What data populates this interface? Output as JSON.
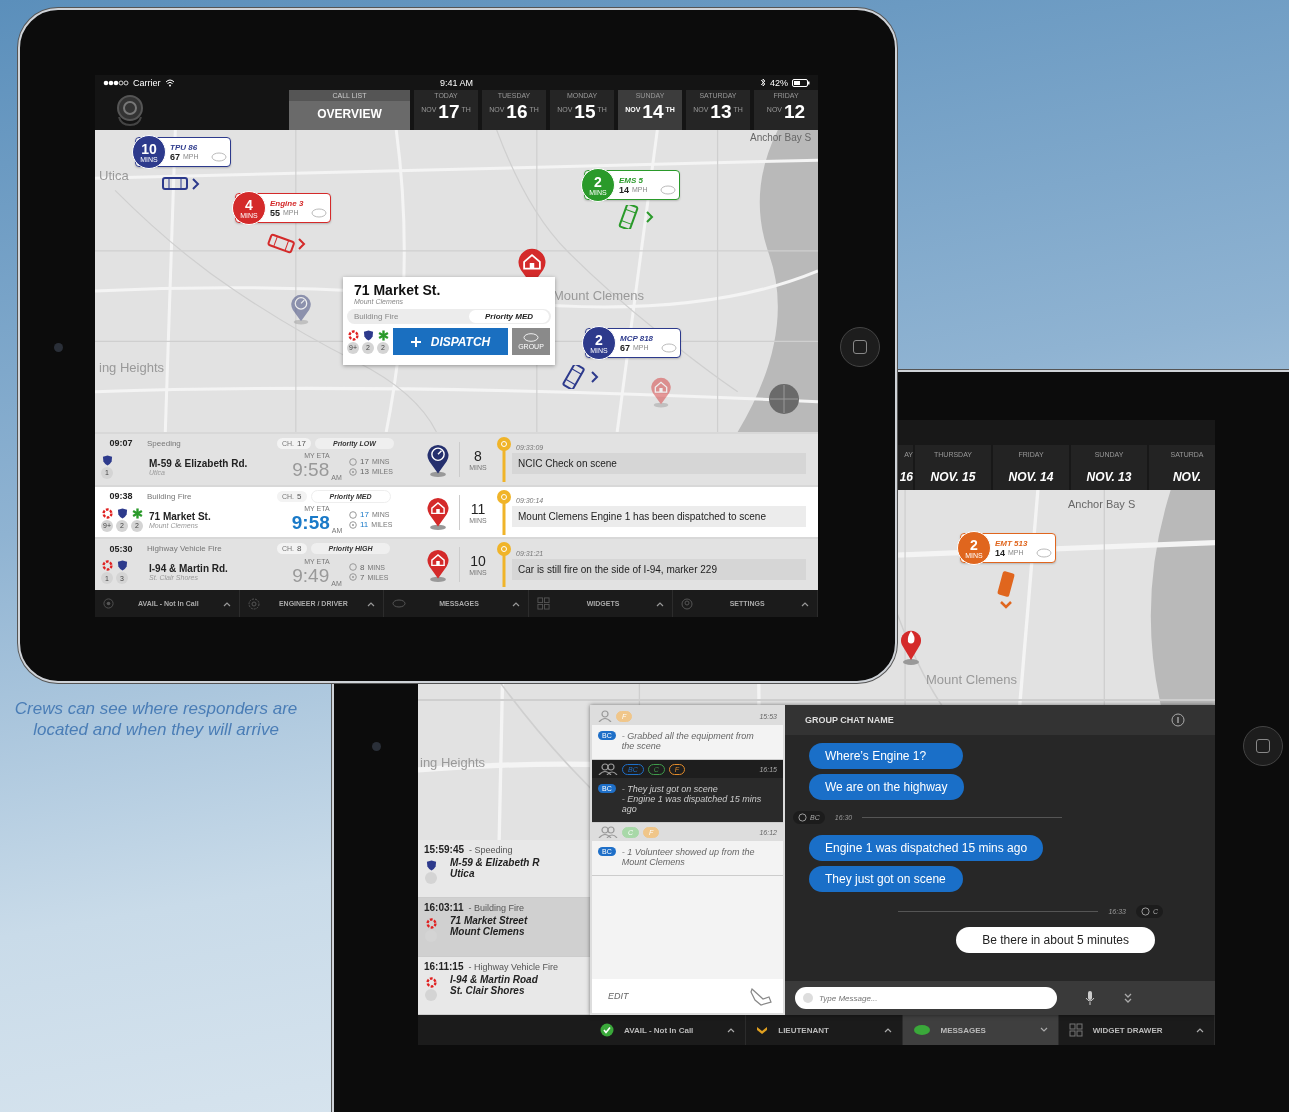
{
  "caption": "Crews can see where responders are located and when they will arrive",
  "front": {
    "status_bar": {
      "carrier": "Carrier",
      "time": "9:41 AM",
      "battery": "42%"
    },
    "overview_tab": {
      "label": "CALL LIST",
      "title": "OVERVIEW",
      "selected": true
    },
    "days": [
      {
        "weekday": "TODAY",
        "month": "NOV",
        "day": "17",
        "suffix": "TH",
        "selected": false
      },
      {
        "weekday": "TUESDAY",
        "month": "NOV",
        "day": "16",
        "suffix": "TH",
        "selected": false
      },
      {
        "weekday": "MONDAY",
        "month": "NOV",
        "day": "15",
        "suffix": "TH",
        "selected": false
      },
      {
        "weekday": "SUNDAY",
        "month": "NOV",
        "day": "14",
        "suffix": "TH",
        "selected": true
      },
      {
        "weekday": "SATURDAY",
        "month": "NOV",
        "day": "13",
        "suffix": "TH",
        "selected": false
      },
      {
        "weekday": "FRIDAY",
        "month": "NOV",
        "day": "12",
        "selected": false
      }
    ],
    "map": {
      "places": [
        "Utica",
        "Mount Clemens",
        "ing Heights",
        "Anchor Bay S"
      ],
      "units": [
        {
          "eta": "10",
          "eta_unit": "MINS",
          "name": "TPU 86",
          "speed": "67",
          "speed_unit": "MPH",
          "color": "#2d3a8c"
        },
        {
          "eta": "4",
          "eta_unit": "MINS",
          "name": "Engine 3",
          "speed": "55",
          "speed_unit": "MPH",
          "color": "#d42a2a"
        },
        {
          "eta": "2",
          "eta_unit": "MINS",
          "name": "EMS 5",
          "speed": "14",
          "speed_unit": "MPH",
          "color": "#2a9a2a"
        },
        {
          "eta": "2",
          "eta_unit": "MINS",
          "name": "MCP 818",
          "speed": "67",
          "speed_unit": "MPH",
          "color": "#2d3a8c"
        }
      ],
      "pins": [
        {
          "kind": "police",
          "faded": true
        },
        {
          "kind": "fire",
          "faded": false
        },
        {
          "kind": "fire",
          "faded": true
        }
      ],
      "popup": {
        "address": "71 Market St.",
        "city": "Mount Clemens",
        "type": "Building Fire",
        "priority": "Priority MED",
        "resources": [
          {
            "kind": "fire",
            "count": "9+"
          },
          {
            "kind": "police",
            "count": "2"
          },
          {
            "kind": "medical",
            "count": "2"
          }
        ],
        "dispatch": "DISPATCH",
        "group": "GROUP"
      }
    },
    "calls": [
      {
        "time": "09:07",
        "type": "Speeding",
        "channel_label": "CH.",
        "channel": "17",
        "priority": "Priority LOW",
        "pin": {
          "kind": "police"
        },
        "selected": false,
        "resources": [
          {
            "kind": "police",
            "count": "1"
          }
        ],
        "address": "M-59 & Elizabeth Rd.",
        "city": "Utica",
        "eta_label": "MY ETA",
        "eta": "9:58",
        "ampm": "AM",
        "mins": "17",
        "mins_unit": "MINS",
        "miles": "13",
        "miles_unit": "MILES",
        "elapsed": "8",
        "elapsed_unit": "MINS",
        "note_time": "09:33:09",
        "note": "NCIC Check on scene"
      },
      {
        "time": "09:38",
        "type": "Building Fire",
        "channel_label": "CH.",
        "channel": "5",
        "priority": "Priority MED",
        "pin": {
          "kind": "fire"
        },
        "selected": true,
        "resources": [
          {
            "kind": "fire",
            "count": "9+"
          },
          {
            "kind": "police",
            "count": "2"
          },
          {
            "kind": "medical",
            "count": "2"
          }
        ],
        "address": "71 Market St.",
        "city": "Mount Clemens",
        "eta_label": "MY ETA",
        "eta": "9:58",
        "ampm": "AM",
        "mins": "17",
        "mins_unit": "MINS",
        "miles": "11",
        "miles_unit": "MILES",
        "elapsed": "11",
        "elapsed_unit": "MINS",
        "note_time": "09:30:14",
        "note": "Mount Clemens Engine 1 has been dispatched to scene"
      },
      {
        "time": "05:30",
        "type": "Highway Vehicle Fire",
        "channel_label": "CH.",
        "channel": "8",
        "priority": "Priority HIGH",
        "pin": {
          "kind": "fire"
        },
        "selected": false,
        "resources": [
          {
            "kind": "fire",
            "count": "1"
          },
          {
            "kind": "police",
            "count": "3"
          }
        ],
        "address": "I-94 & Martin Rd.",
        "city": "St. Clair Shores",
        "eta_label": "MY ETA",
        "eta": "9:49",
        "ampm": "AM",
        "mins": "8",
        "mins_unit": "MINS",
        "miles": "7",
        "miles_unit": "MILES",
        "elapsed": "10",
        "elapsed_unit": "MINS",
        "note_time": "09:31:21",
        "note": "Car is still fire on the side of I-94, marker 229"
      }
    ],
    "toolbar": [
      {
        "kind": "status",
        "label": "AVAIL - Not In Call"
      },
      {
        "kind": "role",
        "label": "ENGINEER / DRIVER"
      },
      {
        "kind": "messages",
        "label": "MESSAGES"
      },
      {
        "kind": "widgets",
        "label": "WIDGETS"
      },
      {
        "kind": "settings",
        "label": "SETTINGS"
      }
    ]
  },
  "back": {
    "days": [
      {
        "weekday": "AY",
        "date": "16"
      },
      {
        "weekday": "THURSDAY",
        "date": "NOV. 15"
      },
      {
        "weekday": "FRIDAY",
        "date": "NOV. 14"
      },
      {
        "weekday": "SUNDAY",
        "date": "NOV. 13"
      },
      {
        "weekday": "SATURDA",
        "date": "NOV."
      }
    ],
    "map": {
      "places": [
        "Anchor Bay S",
        "Mount Clemens",
        "ing Heights"
      ],
      "unit": {
        "eta": "2",
        "eta_unit": "MINS",
        "name": "EMT 513",
        "speed": "14",
        "speed_unit": "MPH",
        "color": "#e0661e"
      }
    },
    "calls": [
      {
        "time": "15:59:45",
        "type": "- Speeding",
        "kind": "police",
        "address": "M-59 & Elizabeth R",
        "city": "Utica",
        "selected": false
      },
      {
        "time": "16:03:11",
        "type": "- Building Fire",
        "kind": "fire",
        "address": "71 Market Street",
        "city": "Mount Clemens",
        "selected": true
      },
      {
        "time": "16:11:15",
        "type": "- Highway Vehicle Fire",
        "kind": "fire",
        "address": "I-94 & Martin Road",
        "city": "St. Clair Shores",
        "selected": false
      }
    ],
    "threads": [
      {
        "group": false,
        "tags": [
          {
            "label": "F",
            "color": "#f0c68a"
          }
        ],
        "time": "15:53",
        "author": "BC",
        "text": "- Grabbed all the equipment from the scene",
        "selected": false
      },
      {
        "group": true,
        "tags": [
          {
            "label": "BC",
            "color": "#1e6fc8"
          },
          {
            "label": "C",
            "color": "#3f9a4a"
          },
          {
            "label": "F",
            "color": "#e08a2a"
          }
        ],
        "time": "16:15",
        "author": "BC",
        "text": "- They just got on scene\n- Engine 1 was dispatched 15 mins ago",
        "selected": true
      },
      {
        "group": true,
        "tags": [
          {
            "label": "C",
            "color": "#a8d8a8"
          },
          {
            "label": "F",
            "color": "#f0c68a"
          }
        ],
        "time": "16:12",
        "author": "BC",
        "text": "- 1 Volunteer showed up from the Mount Clemens",
        "selected": false
      }
    ],
    "edit": "EDIT",
    "chat": {
      "title": "GROUP CHAT NAME",
      "messages": [
        {
          "kind": "incoming",
          "text": "Where’s Engine 1?"
        },
        {
          "kind": "incoming",
          "text": "We are on the highway"
        },
        {
          "kind": "meta",
          "sender": "BC",
          "time": "16:30"
        },
        {
          "kind": "incoming",
          "text": "Engine 1 was dispatched 15 mins ago"
        },
        {
          "kind": "incoming",
          "text": "They just got on scene"
        },
        {
          "kind": "selfmeta",
          "sender": "C",
          "time": "16:33"
        },
        {
          "kind": "outgoing",
          "text": "Be there in about 5 minutes"
        }
      ],
      "placeholder": "Type Message..."
    },
    "toolbar": [
      {
        "kind": "status",
        "label": "AVAIL - Not In Call",
        "selected": false
      },
      {
        "kind": "role",
        "label": "LIEUTENANT",
        "selected": false
      },
      {
        "kind": "messages",
        "label": "MESSAGES",
        "selected": true
      },
      {
        "kind": "widgets",
        "label": "WIDGET DRAWER",
        "selected": false
      }
    ]
  }
}
